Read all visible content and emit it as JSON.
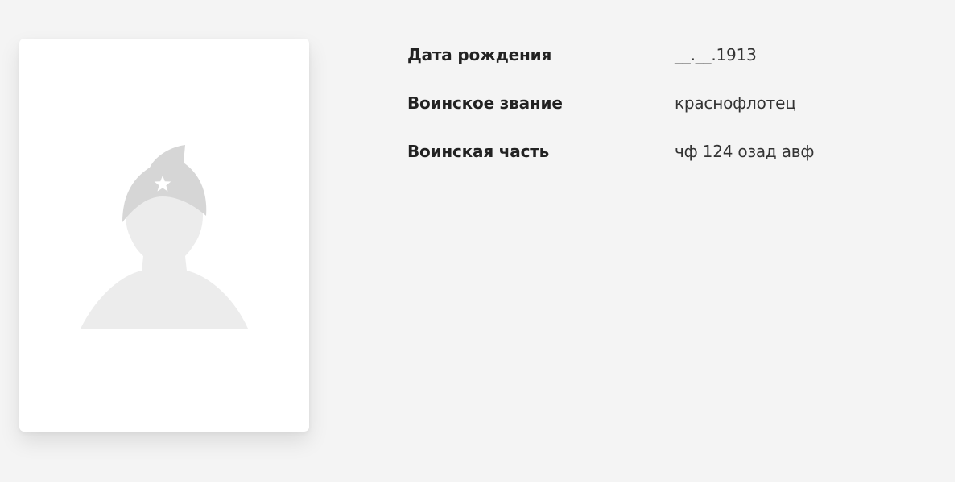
{
  "photo": {
    "alt_icon": "soldier-silhouette-placeholder"
  },
  "fields": [
    {
      "label": "Дата рождения",
      "value": "__.__.1913"
    },
    {
      "label": "Воинское звание",
      "value": "краснофлотец"
    },
    {
      "label": "Воинская часть",
      "value": "чф 124 озад авф"
    }
  ],
  "colors": {
    "background": "#f4f4f4",
    "card": "#ffffff",
    "silhouette": "#ececec",
    "cap": "#d6d6d6"
  }
}
